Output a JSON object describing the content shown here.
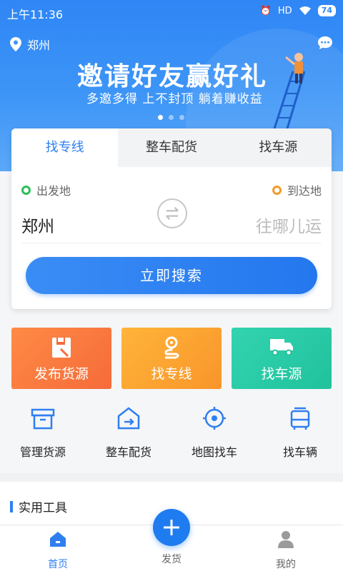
{
  "status_bar": {
    "time": "上午11:36",
    "battery": "74",
    "network": "HD"
  },
  "header": {
    "city": "郑州"
  },
  "banner": {
    "title": "邀请好友赢好礼",
    "subtitle": "多邀多得 上不封顶 躺着赚收益",
    "slide_count": 3,
    "active_slide": 0
  },
  "search": {
    "tabs": [
      {
        "label": "找专线",
        "active": true
      },
      {
        "label": "整车配货",
        "active": false
      },
      {
        "label": "找车源",
        "active": false
      }
    ],
    "from_label": "出发地",
    "to_label": "到达地",
    "from_value": "郑州",
    "to_placeholder": "往哪儿运",
    "button": "立即搜索"
  },
  "tiles": [
    {
      "label": "发布货源",
      "color": "#f56b3a"
    },
    {
      "label": "找专线",
      "color": "#f8952a"
    },
    {
      "label": "找车源",
      "color": "#20c29c"
    }
  ],
  "quick_actions": [
    {
      "label": "管理货源",
      "icon": "box-icon"
    },
    {
      "label": "整车配货",
      "icon": "warehouse-icon"
    },
    {
      "label": "地图找车",
      "icon": "locate-icon"
    },
    {
      "label": "找车辆",
      "icon": "bus-icon"
    }
  ],
  "tools": {
    "title": "实用工具"
  },
  "nav": {
    "home": "首页",
    "post": "发货",
    "mine": "我的"
  },
  "colors": {
    "primary": "#2f7ff0",
    "orange": "#f56b3a",
    "amber": "#f8952a",
    "teal": "#20c29c"
  }
}
